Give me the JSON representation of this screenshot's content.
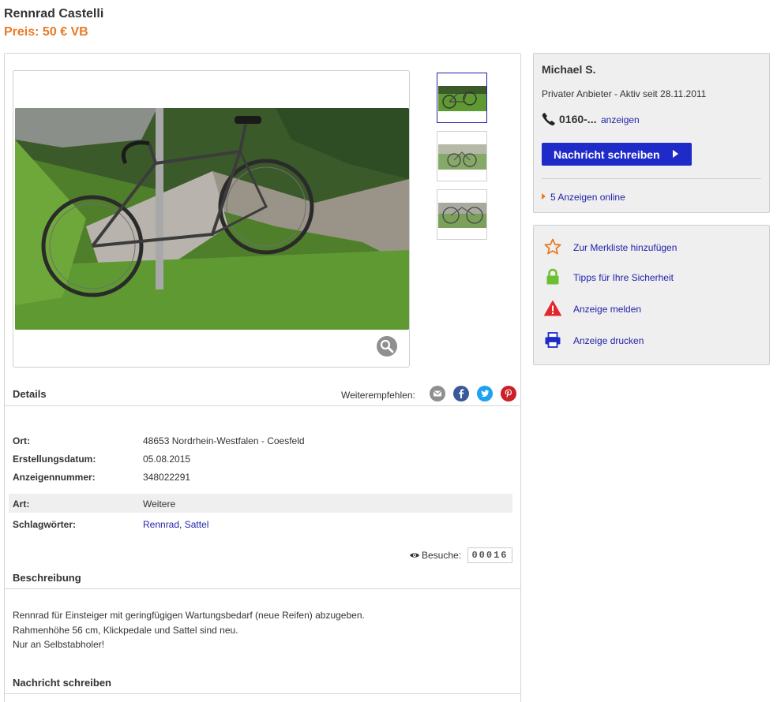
{
  "listing": {
    "title": "Rennrad Castelli",
    "price": "Preis: 50 € VB"
  },
  "gallery": {
    "thumbnails": [
      "bike-photo-1",
      "bike-photo-2",
      "bike-photo-3"
    ],
    "active_index": 0
  },
  "details": {
    "heading": "Details",
    "share_label": "Weiterempfehlen:",
    "share_icons": [
      "email-icon",
      "facebook-icon",
      "twitter-icon",
      "pinterest-icon"
    ],
    "rows": [
      {
        "key": "Ort:",
        "value": "48653 Nordrhein-Westfalen - Coesfeld"
      },
      {
        "key": "Erstellungsdatum:",
        "value": "05.08.2015"
      },
      {
        "key": "Anzeigennummer:",
        "value": "348022291"
      }
    ],
    "art_key": "Art:",
    "art_value": "Weitere",
    "tags_key": "Schlagwörter:",
    "tags": [
      "Rennrad",
      "Sattel"
    ],
    "tags_separator": ",",
    "visits_label": "Besuche:",
    "visits_count": "00016"
  },
  "description": {
    "heading": "Beschreibung",
    "lines": [
      "Rennrad für Einsteiger mit geringfügigen Wartungsbedarf (neue Reifen) abzugeben.",
      "Rahmenhöhe 56 cm, Klickpedale und Sattel sind neu.",
      "Nur an Selbstabholer!"
    ]
  },
  "message_section": {
    "heading": "Nachricht schreiben"
  },
  "seller": {
    "name": "Michael S.",
    "since": "Privater Anbieter - Aktiv seit 28.11.2011",
    "phone": "0160-...",
    "phone_reveal": "anzeigen",
    "message_button": "Nachricht schreiben",
    "ads_online": "5 Anzeigen online"
  },
  "actions": [
    {
      "icon": "star-icon",
      "label": "Zur Merkliste hinzufügen"
    },
    {
      "icon": "lock-icon",
      "label": "Tipps für Ihre Sicherheit"
    },
    {
      "icon": "warning-icon",
      "label": "Anzeige melden"
    },
    {
      "icon": "printer-icon",
      "label": "Anzeige drucken"
    }
  ],
  "colors": {
    "price": "#e87b26",
    "link": "#2222aa",
    "button": "#1e2bc9",
    "facebook": "#3b5998",
    "twitter": "#1da1f2",
    "pinterest": "#cb2027",
    "email": "#8f8f8f"
  }
}
